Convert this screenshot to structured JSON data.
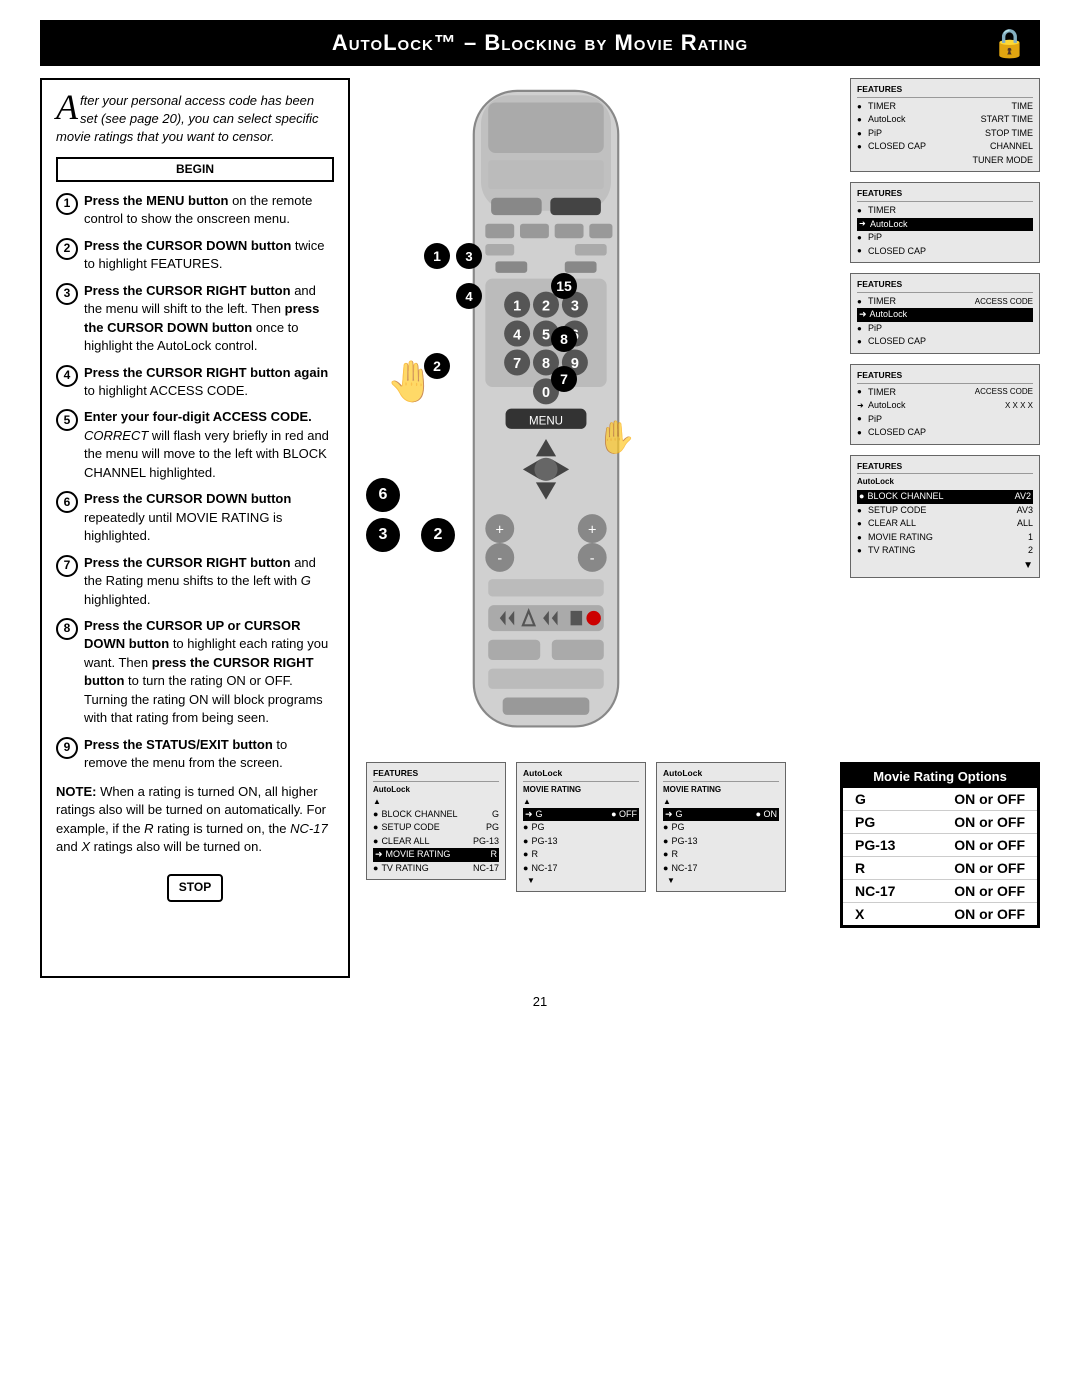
{
  "header": {
    "title": "AutoLock™ – Blocking by Movie Rating",
    "lock_icon": "🔒"
  },
  "intro": {
    "drop_cap": "A",
    "text": "fter your personal access code has been set (see page 20), you can select specific movie ratings that you want to censor."
  },
  "begin_label": "BEGIN",
  "stop_label": "STOP",
  "steps": [
    {
      "num": "1",
      "text_parts": [
        {
          "bold": true,
          "text": "Press the MENU button"
        },
        {
          "bold": false,
          "text": " on the remote control to show the onscreen menu."
        }
      ]
    },
    {
      "num": "2",
      "text_parts": [
        {
          "bold": true,
          "text": "Press the CURSOR DOWN button"
        },
        {
          "bold": false,
          "text": " twice to highlight FEATURES."
        }
      ]
    },
    {
      "num": "3",
      "text_parts": [
        {
          "bold": true,
          "text": "Press the CURSOR RIGHT button"
        },
        {
          "bold": false,
          "text": " and the menu will shift to the left. Then "
        },
        {
          "bold": true,
          "text": "press the CURSOR DOWN button"
        },
        {
          "bold": false,
          "text": " once to highlight the AutoLock control."
        }
      ]
    },
    {
      "num": "4",
      "text_parts": [
        {
          "bold": true,
          "text": "Press the CURSOR RIGHT button again"
        },
        {
          "bold": false,
          "text": " to highlight ACCESS CODE."
        }
      ]
    },
    {
      "num": "5",
      "text_parts": [
        {
          "bold": true,
          "text": "Enter your four-digit ACCESS CODE."
        },
        {
          "bold": false,
          "italic": true,
          "text": " CORRECT"
        },
        {
          "bold": false,
          "text": " will flash very briefly in red and the menu will move to the left with BLOCK CHANNEL highlighted."
        }
      ]
    },
    {
      "num": "6",
      "text_parts": [
        {
          "bold": true,
          "text": "Press the CURSOR DOWN button"
        },
        {
          "bold": false,
          "text": " repeatedly until MOVIE RATING is highlighted."
        }
      ]
    },
    {
      "num": "7",
      "text_parts": [
        {
          "bold": true,
          "text": "Press the CURSOR RIGHT button"
        },
        {
          "bold": false,
          "text": " and the Rating menu shifts to the left with "
        },
        {
          "bold": false,
          "italic": true,
          "text": "G"
        },
        {
          "bold": false,
          "text": " highlighted."
        }
      ]
    },
    {
      "num": "8",
      "text_parts": [
        {
          "bold": true,
          "text": "Press the CURSOR UP or CURSOR DOWN button"
        },
        {
          "bold": false,
          "text": " to highlight each rating you want. Then "
        },
        {
          "bold": true,
          "text": "press the CURSOR RIGHT button"
        },
        {
          "bold": false,
          "text": " to turn the rating ON or OFF. Turning the rating ON will block programs with that rating from being seen."
        }
      ]
    },
    {
      "num": "9",
      "text_parts": [
        {
          "bold": true,
          "text": "Press the STATUS/EXIT button"
        },
        {
          "bold": false,
          "text": " to remove the menu from the screen."
        }
      ]
    }
  ],
  "note": {
    "label": "NOTE:",
    "text": "When a rating is turned ON, all higher ratings also will be turned on automatically. For example, if the R rating is turned on, the NC-17 and X ratings also will be turned on."
  },
  "menu_screens": [
    {
      "id": "menu1",
      "title": "FEATURES",
      "items": [
        {
          "bullet": "●",
          "text": "TIMER",
          "right": "TIME",
          "highlighted": false
        },
        {
          "bullet": "●",
          "text": "AutoLock",
          "right": "START TIME",
          "highlighted": false
        },
        {
          "bullet": "●",
          "text": "PiP",
          "right": "STOP TIME",
          "highlighted": false
        },
        {
          "bullet": "●",
          "text": "CLOSED CAP",
          "right": "CHANNEL",
          "highlighted": false
        },
        {
          "bullet": "",
          "text": "",
          "right": "TUNER MODE",
          "highlighted": false
        }
      ]
    },
    {
      "id": "menu2",
      "title": "FEATURES",
      "items": [
        {
          "bullet": "●",
          "text": "TIMER",
          "right": "",
          "highlighted": false
        },
        {
          "bullet": "➜",
          "text": "AutoLock",
          "right": "",
          "highlighted": true
        },
        {
          "bullet": "●",
          "text": "PiP",
          "right": "",
          "highlighted": false
        },
        {
          "bullet": "●",
          "text": "CLOSED CAP",
          "right": "",
          "highlighted": false
        }
      ]
    },
    {
      "id": "menu3",
      "title": "FEATURES",
      "items": [
        {
          "bullet": "●",
          "text": "TIMER",
          "right": "ACCESS CODE",
          "highlighted": false
        },
        {
          "bullet": "➜",
          "text": "AutoLock",
          "right": "",
          "highlighted": true
        },
        {
          "bullet": "●",
          "text": "PiP",
          "right": "",
          "highlighted": false
        },
        {
          "bullet": "●",
          "text": "CLOSED CAP",
          "right": "",
          "highlighted": false
        }
      ],
      "access_code_box": true
    },
    {
      "id": "menu4",
      "title": "FEATURES",
      "items": [
        {
          "bullet": "●",
          "text": "TIMER",
          "right": "ACCESS CODE",
          "highlighted": false
        },
        {
          "bullet": "➜",
          "text": "AutoLock",
          "right": "X X X X",
          "highlighted": false
        },
        {
          "bullet": "●",
          "text": "PiP",
          "right": "",
          "highlighted": false
        },
        {
          "bullet": "●",
          "text": "CLOSED CAP",
          "right": "",
          "highlighted": false
        }
      ]
    },
    {
      "id": "menu5",
      "title": "FEATURES",
      "subtitle": "AutoLock",
      "items": [
        {
          "bullet": "●",
          "text": "BLOCK CHANNEL",
          "right": "AV2",
          "highlighted": true
        },
        {
          "bullet": "●",
          "text": "SETUP CODE",
          "right": "AV3",
          "highlighted": false
        },
        {
          "bullet": "●",
          "text": "CLEAR ALL",
          "right": "ALL",
          "highlighted": false
        },
        {
          "bullet": "●",
          "text": "MOVIE RATING",
          "right": "1",
          "highlighted": false
        },
        {
          "bullet": "●",
          "text": "TV RATING",
          "right": "2",
          "highlighted": false
        }
      ]
    }
  ],
  "bottom_menus_left": [
    {
      "id": "bl1",
      "title": "FEATURES",
      "subtitle": "AutoLock",
      "items": [
        {
          "bullet": "●",
          "text": "BLOCK CHANNEL",
          "right": "G",
          "highlighted": false
        },
        {
          "bullet": "●",
          "text": "SETUP CODE",
          "right": "PG",
          "highlighted": false
        },
        {
          "bullet": "●",
          "text": "CLEAR ALL",
          "right": "PG-13",
          "highlighted": false
        },
        {
          "bullet": "➜",
          "text": "MOVIE RATING",
          "right": "R",
          "highlighted": true
        },
        {
          "bullet": "●",
          "text": "TV RATING",
          "right": "NC-17",
          "highlighted": false
        }
      ]
    },
    {
      "id": "bl2",
      "title": "AutoLock",
      "subtitle": "MOVIE RATING",
      "items": [
        {
          "bullet": "➜",
          "text": "G",
          "right": "● OFF",
          "highlighted": true
        },
        {
          "bullet": "●",
          "text": "PG",
          "right": "",
          "highlighted": false
        },
        {
          "bullet": "●",
          "text": "PG-13",
          "right": "",
          "highlighted": false
        },
        {
          "bullet": "●",
          "text": "R",
          "right": "",
          "highlighted": false
        },
        {
          "bullet": "●",
          "text": "NC-17",
          "right": "",
          "highlighted": false
        }
      ]
    }
  ],
  "bottom_menu_autolock": {
    "title": "AutoLock",
    "subtitle": "MOVIE RATING",
    "items": [
      {
        "bullet": "➜",
        "text": "G",
        "right": "● ON",
        "highlighted": true
      },
      {
        "bullet": "●",
        "text": "PG",
        "right": "",
        "highlighted": false
      },
      {
        "bullet": "●",
        "text": "PG-13",
        "right": "",
        "highlighted": false
      },
      {
        "bullet": "●",
        "text": "R",
        "right": "",
        "highlighted": false
      },
      {
        "bullet": "●",
        "text": "NC-17",
        "right": "",
        "highlighted": false
      }
    ]
  },
  "rating_table": {
    "header": "Movie Rating Options",
    "rows": [
      {
        "rating": "G",
        "option": "ON or OFF"
      },
      {
        "rating": "PG",
        "option": "ON or OFF"
      },
      {
        "rating": "PG-13",
        "option": "ON or OFF"
      },
      {
        "rating": "R",
        "option": "ON or OFF"
      },
      {
        "rating": "NC-17",
        "option": "ON or OFF"
      },
      {
        "rating": "X",
        "option": "ON or OFF"
      }
    ]
  },
  "page_number": "21",
  "step_callouts": [
    {
      "num": "1",
      "desc": "step1-callout"
    },
    {
      "num": "2",
      "desc": "step2-callout"
    },
    {
      "num": "3",
      "desc": "step3-callout"
    },
    {
      "num": "4",
      "desc": "step4-callout"
    },
    {
      "num": "5",
      "desc": "step5-callout"
    },
    {
      "num": "6",
      "desc": "step6-callout"
    },
    {
      "num": "7",
      "desc": "step7-callout"
    },
    {
      "num": "8",
      "desc": "step8-callout"
    }
  ]
}
